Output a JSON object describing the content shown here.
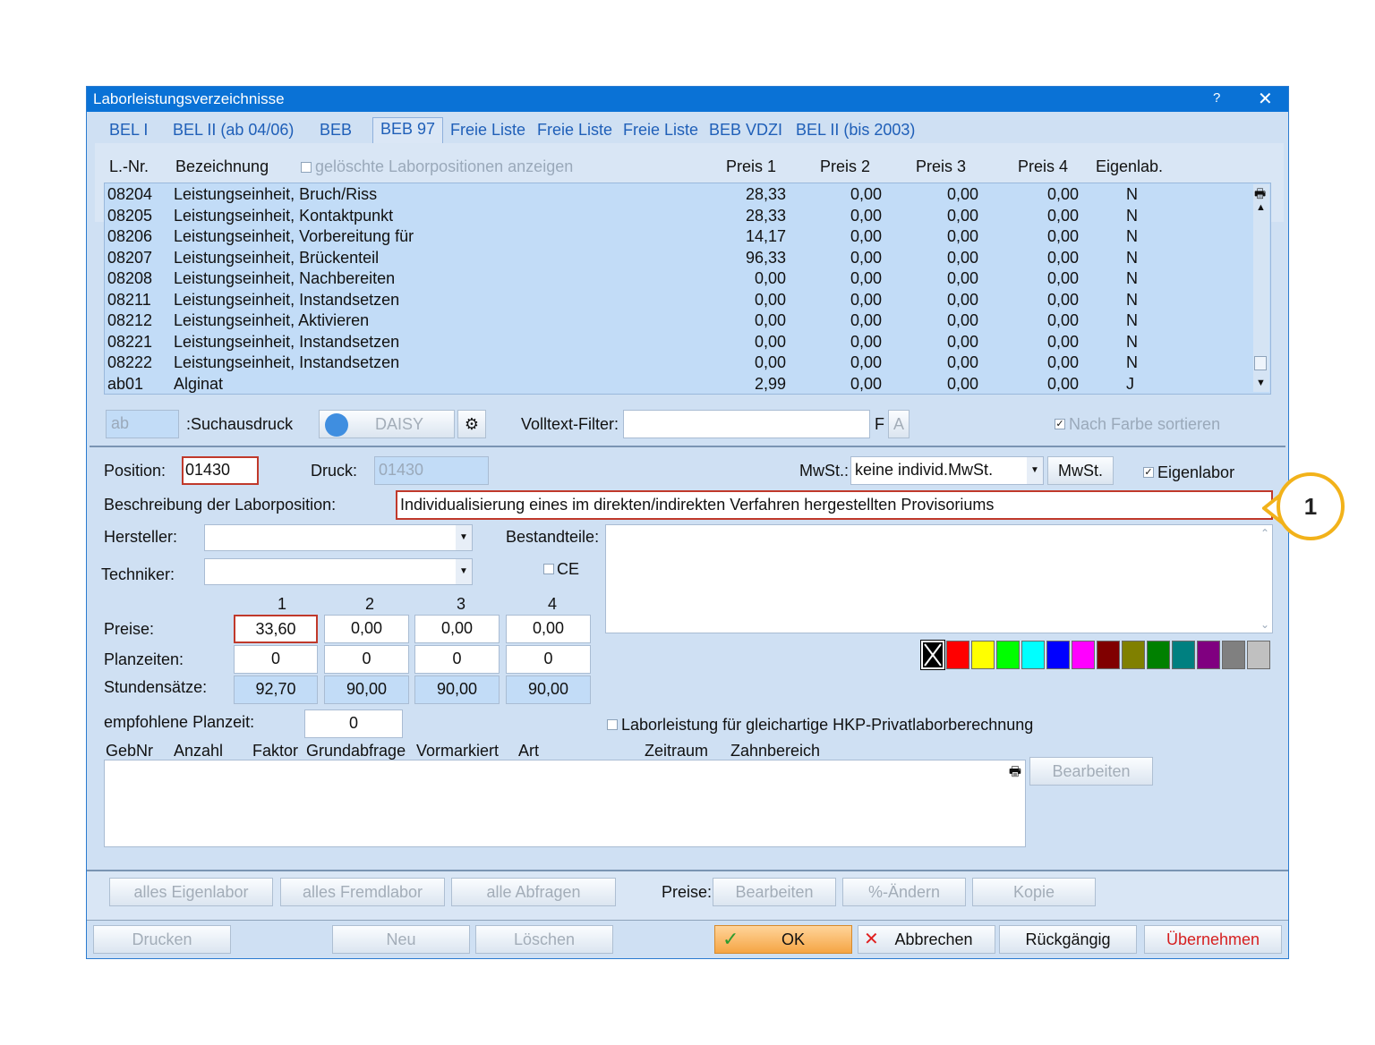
{
  "window": {
    "title": "Laborleistungsverzeichnisse",
    "help": "?",
    "close": "✕"
  },
  "tabs": [
    "BEL I",
    "BEL II (ab 04/06)",
    "BEB",
    "BEB 97",
    "Freie Liste",
    "Freie Liste",
    "Freie Liste",
    "BEB VDZI",
    "BEL II (bis 2003)"
  ],
  "list": {
    "headers": {
      "lnr": "L.-Nr.",
      "bezeichnung": "Bezeichnung",
      "deleted": "gelöschte Laborpositionen anzeigen",
      "p1": "Preis 1",
      "p2": "Preis 2",
      "p3": "Preis 3",
      "p4": "Preis 4",
      "eigen": "Eigenlab."
    },
    "rows": [
      [
        "08204",
        "Leistungseinheit, Bruch/Riss",
        "28,33",
        "0,00",
        "0,00",
        "0,00",
        "N"
      ],
      [
        "08205",
        "Leistungseinheit, Kontaktpunkt",
        "28,33",
        "0,00",
        "0,00",
        "0,00",
        "N"
      ],
      [
        "08206",
        "Leistungseinheit, Vorbereitung für",
        "14,17",
        "0,00",
        "0,00",
        "0,00",
        "N"
      ],
      [
        "08207",
        "Leistungseinheit, Brückenteil",
        "96,33",
        "0,00",
        "0,00",
        "0,00",
        "N"
      ],
      [
        "08208",
        "Leistungseinheit, Nachbereiten",
        "0,00",
        "0,00",
        "0,00",
        "0,00",
        "N"
      ],
      [
        "08211",
        "Leistungseinheit, Instandsetzen",
        "0,00",
        "0,00",
        "0,00",
        "0,00",
        "N"
      ],
      [
        "08212",
        "Leistungseinheit,  Aktivieren",
        "0,00",
        "0,00",
        "0,00",
        "0,00",
        "N"
      ],
      [
        "08221",
        "Leistungseinheit,  Instandsetzen",
        "0,00",
        "0,00",
        "0,00",
        "0,00",
        "N"
      ],
      [
        "08222",
        "Leistungseinheit,  Instandsetzen",
        "0,00",
        "0,00",
        "0,00",
        "0,00",
        "N"
      ],
      [
        "ab01",
        "Alginat",
        "2,99",
        "0,00",
        "0,00",
        "0,00",
        "J"
      ]
    ]
  },
  "search": {
    "value": "ab",
    "label": ":Suchausdruck",
    "daisy": "DAISY",
    "fulltext_label": "Volltext-Filter:",
    "f": "F",
    "a": "A",
    "color_sort": "Nach Farbe sortieren"
  },
  "detail": {
    "position_label": "Position:",
    "position_value": "01430",
    "druck_label": "Druck:",
    "druck_value": "01430",
    "mwst_label": "MwSt.:",
    "mwst_value": "keine individ.MwSt.",
    "mwst_button": "MwSt.",
    "eigenlabor": "Eigenlabor",
    "beschreibung_label": "Beschreibung der Laborposition:",
    "beschreibung_value": "Individualisierung eines im direkten/indirekten Verfahren hergestellten Provisoriums",
    "hersteller_label": "Hersteller:",
    "techniker_label": "Techniker:",
    "bestandteile_label": "Bestandteile:",
    "ce": "CE",
    "cols": [
      "1",
      "2",
      "3",
      "4"
    ],
    "preise_label": "Preise:",
    "preise": [
      "33,60",
      "0,00",
      "0,00",
      "0,00"
    ],
    "planzeiten_label": "Planzeiten:",
    "planzeiten": [
      "0",
      "0",
      "0",
      "0"
    ],
    "stundensaetze_label": "Stundensätze:",
    "stundensaetze": [
      "92,70",
      "90,00",
      "90,00",
      "90,00"
    ],
    "empf_label": "empfohlene Planzeit:",
    "empf_value": "0",
    "hkp_label": "Laborleistung für gleichartige HKP-Privatlaborberechnung"
  },
  "gebnr_headers": [
    "GebNr",
    "Anzahl",
    "Faktor",
    "Grundabfrage",
    "Vormarkiert",
    "Art",
    "Zeitraum",
    "Zahnbereich"
  ],
  "bearbeiten": "Bearbeiten",
  "bottom_row1": {
    "alles_eigen": "alles Eigenlabor",
    "alles_fremd": "alles Fremdlabor",
    "alle_abfragen": "alle Abfragen",
    "preise_label": "Preise:",
    "bearbeiten": "Bearbeiten",
    "aendern": "%-Ändern",
    "kopie": "Kopie"
  },
  "bottom_row2": {
    "drucken": "Drucken",
    "neu": "Neu",
    "loeschen": "Löschen",
    "ok": "OK",
    "abbrechen": "Abbrechen",
    "rueckgaengig": "Rückgängig",
    "uebernehmen": "Übernehmen"
  },
  "swatches": [
    "#000000",
    "#ff0000",
    "#ffff00",
    "#00ff00",
    "#00ffff",
    "#0000ff",
    "#ff00ff",
    "#800000",
    "#808000",
    "#008000",
    "#008080",
    "#800080",
    "#808080",
    "#c0c0c0"
  ],
  "callout": "1"
}
